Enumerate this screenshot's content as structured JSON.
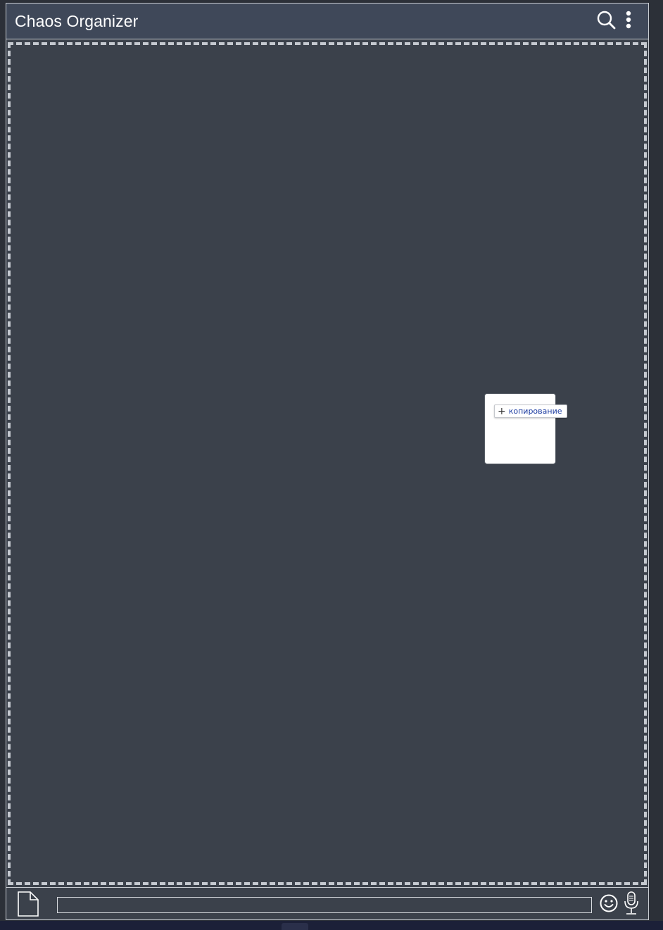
{
  "header": {
    "title": "Chaos Organizer",
    "search_icon": "search-icon",
    "menu_icon": "more-vertical-icon"
  },
  "drop_zone": {
    "dragged_item": {
      "action_label": "копирование",
      "action_icon": "plus-icon"
    }
  },
  "footer": {
    "attach_icon": "file-icon",
    "message_input": {
      "value": "",
      "placeholder": ""
    },
    "emoji_icon": "smiley-icon",
    "mic_icon": "microphone-icon"
  },
  "colors": {
    "header_bg": "#3f4859",
    "body_bg": "#3b414b",
    "border": "#c8ccd2",
    "text": "#ffffff",
    "copy_label": "#1a3aa0"
  }
}
